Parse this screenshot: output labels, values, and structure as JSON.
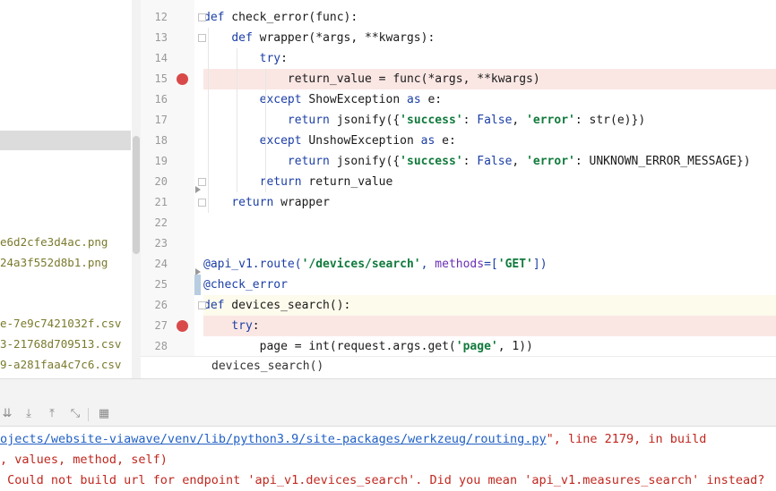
{
  "project_panel": {
    "files": [
      "e6d2cfe3d4ac.png",
      "24a3f552d8b1.png",
      "e-7e9c7421032f.csv",
      "3-21768d709513.csv",
      "9-a281faa4c7c6.csv"
    ]
  },
  "editor": {
    "lines": [
      {
        "num": "12",
        "html": "<span class=\"kw\">def</span> check_error(func):"
      },
      {
        "num": "13",
        "html": "    <span class=\"kw\">def</span> wrapper(*args, **kwargs):"
      },
      {
        "num": "14",
        "html": "        <span class=\"kw\">try</span>:"
      },
      {
        "num": "15",
        "html": "            return_value = func(*args, **kwargs)"
      },
      {
        "num": "16",
        "html": "        <span class=\"kw\">except</span> ShowException <span class=\"kw\">as</span> e:"
      },
      {
        "num": "17",
        "html": "            <span class=\"kw\">return</span> jsonify({<span class=\"str\">'success'</span>: <span class=\"kw\">False</span>, <span class=\"str\">'error'</span>: str(e)})"
      },
      {
        "num": "18",
        "html": "        <span class=\"kw\">except</span> UnshowException <span class=\"kw\">as</span> e:"
      },
      {
        "num": "19",
        "html": "            <span class=\"kw\">return</span> jsonify({<span class=\"str\">'success'</span>: <span class=\"kw\">False</span>, <span class=\"str\">'error'</span>: UNKNOWN_ERROR_MESSAGE})"
      },
      {
        "num": "20",
        "html": "        <span class=\"kw\">return</span> return_value"
      },
      {
        "num": "21",
        "html": "    <span class=\"kw\">return</span> wrapper"
      },
      {
        "num": "22",
        "html": ""
      },
      {
        "num": "23",
        "html": ""
      },
      {
        "num": "24",
        "html": "<span class=\"deco\">@api_v1.route(</span><span class=\"deco-str\">'/devices/search'</span><span class=\"deco\">, </span><span class=\"named\">methods</span><span class=\"deco\">=[</span><span class=\"deco-str\">'GET'</span><span class=\"deco\">])</span>"
      },
      {
        "num": "25",
        "html": "<span class=\"deco\">@check_error</span>"
      },
      {
        "num": "26",
        "html": "<span class=\"kw\">def</span> devices_search():"
      },
      {
        "num": "27",
        "html": "    <span class=\"kw\">try</span>:"
      },
      {
        "num": "28",
        "html": "        page = int(request.args.get(<span class=\"str\">'page'</span>, 1))"
      }
    ],
    "breakpoint_lines": [
      "15",
      "27"
    ],
    "current_line": "26",
    "breadcrumb": "devices_search()"
  },
  "console": {
    "line1_link": "ojects/website-viawave/venv/lib/python3.9/site-packages/werkzeug/routing.py",
    "line1_rest": "\", line 2179, in build",
    "line2": ", values, method, self)",
    "line3": " Could not build url for endpoint 'api_v1.devices_search'. Did you mean 'api_v1.measures_search' instead?"
  },
  "icons": [
    "scroll-to-end-icon",
    "download-icon",
    "upload-icon",
    "collapse-icon",
    "grid-icon"
  ]
}
